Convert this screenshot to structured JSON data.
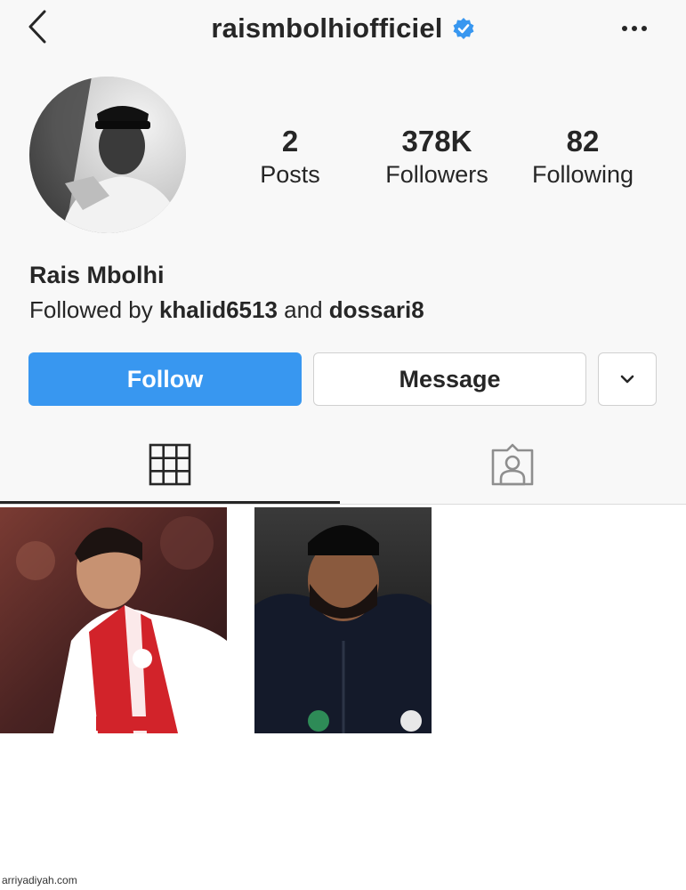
{
  "header": {
    "username": "raismbolhiofficiel",
    "verified": true,
    "back_icon": "chevron-left-icon",
    "more_icon": "more-horizontal-icon"
  },
  "stats": {
    "posts": {
      "count": "2",
      "label": "Posts"
    },
    "followers": {
      "count": "378K",
      "label": "Followers"
    },
    "following": {
      "count": "82",
      "label": "Following"
    }
  },
  "bio": {
    "name": "Rais Mbolhi",
    "followed_by_prefix": "Followed by ",
    "followed_user_1": "khalid6513",
    "followed_joiner": " and ",
    "followed_user_2": "dossari8"
  },
  "actions": {
    "follow_label": "Follow",
    "message_label": "Message",
    "dropdown_icon": "chevron-down-icon"
  },
  "tabs": [
    {
      "name": "grid",
      "icon": "grid-icon",
      "active": true
    },
    {
      "name": "tagged",
      "icon": "tagged-person-icon",
      "active": false
    }
  ],
  "posts": [
    {
      "description": "player in red and white jersey"
    },
    {
      "description": "illustrated portrait in black jacket"
    }
  ],
  "watermark": "arriyadiyah.com",
  "colors": {
    "accent": "#3897f0",
    "text": "#262626",
    "verified_badge": "#3897f0"
  }
}
